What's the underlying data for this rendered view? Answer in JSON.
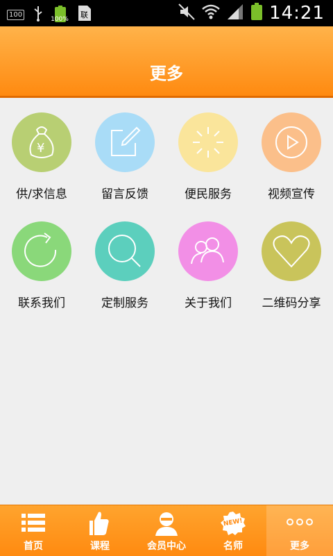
{
  "status_bar": {
    "time": "14:21",
    "left_icons": [
      "battery-100-icon",
      "usb-icon",
      "battery-charging-icon",
      "sim-icon"
    ],
    "right_icons": [
      "mute-icon",
      "wifi-icon",
      "signal-icon",
      "battery-icon"
    ],
    "badge_100": "100",
    "battery_percent": "100%"
  },
  "header": {
    "title": "更多"
  },
  "tiles": [
    {
      "label": "供/求信息",
      "icon": "money-bag-icon",
      "color": "#b8cf73"
    },
    {
      "label": "留言反馈",
      "icon": "edit-icon",
      "color": "#a9dcf7"
    },
    {
      "label": "便民服务",
      "icon": "sparkle-icon",
      "color": "#fae59b"
    },
    {
      "label": "视频宣传",
      "icon": "play-icon",
      "color": "#fbbf8a"
    },
    {
      "label": "联系我们",
      "icon": "refresh-icon",
      "color": "#8ad87a"
    },
    {
      "label": "定制服务",
      "icon": "search-icon",
      "color": "#5ccfbd"
    },
    {
      "label": "关于我们",
      "icon": "users-icon",
      "color": "#f28fe6"
    },
    {
      "label": "二维码分享",
      "icon": "heart-icon",
      "color": "#c9c45b"
    }
  ],
  "tabs": [
    {
      "label": "首页",
      "icon": "list-icon"
    },
    {
      "label": "课程",
      "icon": "thumbs-up-icon"
    },
    {
      "label": "会员中心",
      "icon": "person-icon"
    },
    {
      "label": "名师",
      "icon": "new-badge-icon",
      "badge_text": "NEW!"
    },
    {
      "label": "更多",
      "icon": "more-dots-icon",
      "active": true
    }
  ]
}
